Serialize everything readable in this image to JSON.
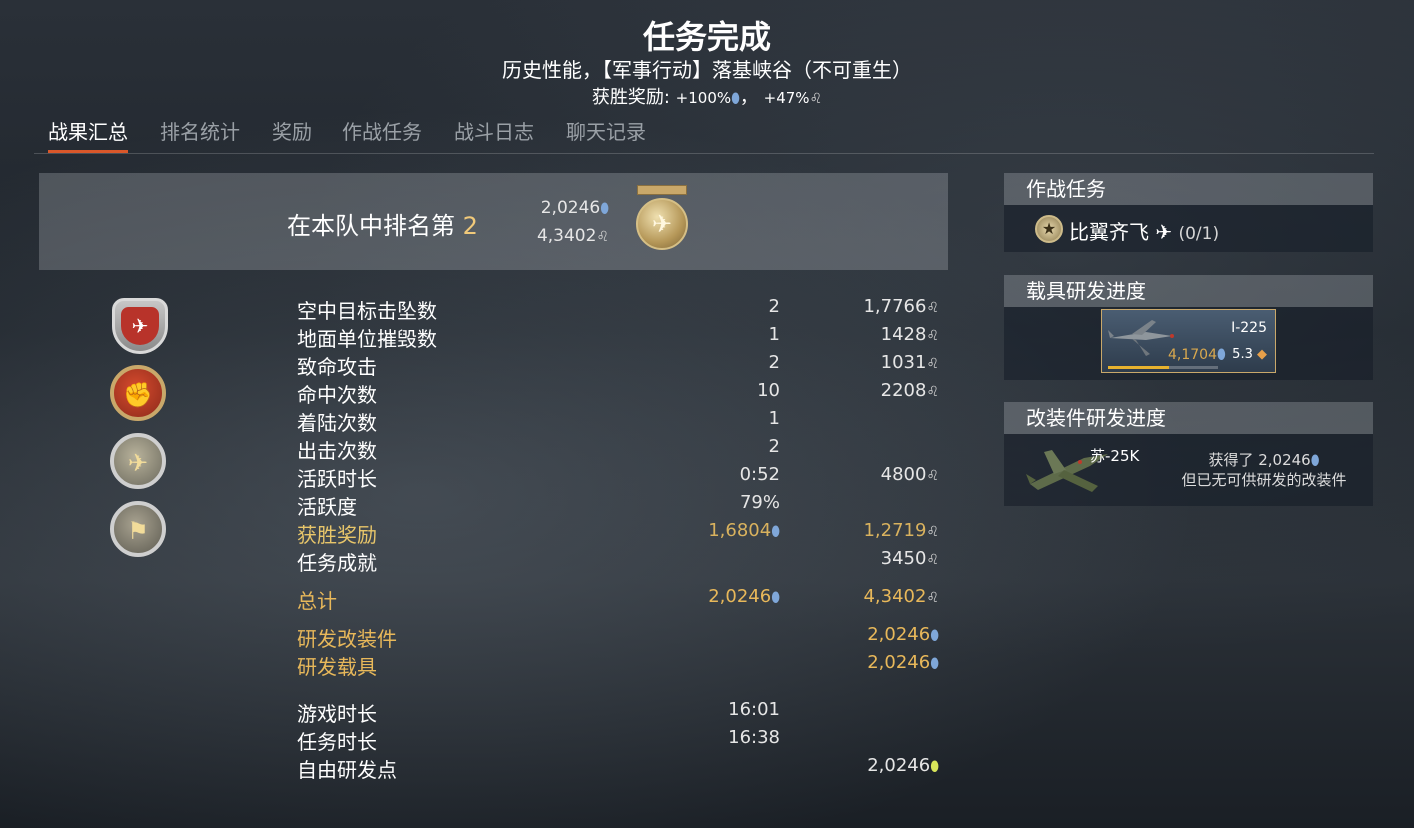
{
  "header": {
    "title": "任务完成",
    "subtitle": "历史性能，【军事行动】落基峡谷（不可重生）",
    "win_bonus_label": "获胜奖励:",
    "win_bonus_rp": "+100%",
    "win_bonus_sep": "，",
    "win_bonus_sl": "+47%"
  },
  "tabs": [
    "战果汇总",
    "排名统计",
    "奖励",
    "作战任务",
    "战斗日志",
    "聊天记录"
  ],
  "rank": {
    "text": "在本队中排名第 ",
    "place": "2",
    "rp": "2,0246",
    "sl": "4,3402"
  },
  "icons": {
    "rp": "research-point-icon",
    "sl": "silver-lion-icon",
    "frp": "free-research-point-icon"
  },
  "stats": [
    {
      "label": "空中目标击坠数",
      "count": "2",
      "reward": "1,7766"
    },
    {
      "label": "地面单位摧毁数",
      "count": "1",
      "reward": "1428"
    },
    {
      "label": "致命攻击",
      "count": "2",
      "reward": "1031"
    },
    {
      "label": "命中次数",
      "count": "10",
      "reward": "2208"
    },
    {
      "label": "着陆次数",
      "count": "1",
      "reward": ""
    },
    {
      "label": "出击次数",
      "count": "2",
      "reward": ""
    },
    {
      "label": "活跃时长",
      "count": "0:52",
      "reward": "4800"
    },
    {
      "label": "活跃度",
      "count": "79%",
      "reward": ""
    },
    {
      "label": "获胜奖励",
      "count": "1,6804",
      "reward": "1,2719"
    },
    {
      "label": "任务成就",
      "count": "",
      "reward": "3450"
    }
  ],
  "total": {
    "label": "总计",
    "rp": "2,0246",
    "sl": "4,3402"
  },
  "research": [
    {
      "label": "研发改装件",
      "rp": "2,0246"
    },
    {
      "label": "研发载具",
      "rp": "2,0246"
    }
  ],
  "times": [
    {
      "label": "游戏时长",
      "value": "16:01"
    },
    {
      "label": "任务时长",
      "value": "16:38"
    }
  ],
  "free_rp": {
    "label": "自由研发点",
    "value": "2,0246"
  },
  "right": {
    "tasks_title": "作战任务",
    "task_name": "比翼齐飞",
    "task_progress": "(0/1)",
    "vehicle_title": "载具研发进度",
    "vehicle_name": "I-225",
    "vehicle_rp": "4,1704",
    "vehicle_br": "5.3",
    "vehicle_progress": 0.55,
    "mod_title": "改装件研发进度",
    "mod_vehicle": "苏-25K",
    "mod_got_prefix": "获得了 ",
    "mod_got_rp": "2,0246",
    "mod_none": "但已无可供研发的改装件"
  }
}
